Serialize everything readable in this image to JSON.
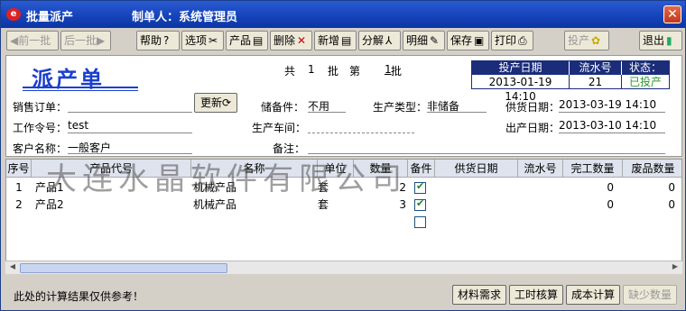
{
  "window": {
    "title": "批量派产",
    "creator": "制单人：系统管理员",
    "close_glyph": "✕"
  },
  "toolbar": {
    "prev_batch": "前一批",
    "next_batch": "后一批",
    "help": "帮助",
    "options": "选项",
    "product": "产品",
    "delete": "删除",
    "add": "新增",
    "decompose": "分解",
    "detail": "明细",
    "save": "保存",
    "print": "打印",
    "produce": "投产",
    "exit": "退出"
  },
  "header": {
    "doc_title": "派产单",
    "batch_total_label": "共",
    "batch_total": "1",
    "batch_unit": "批",
    "batch_no_label": "第",
    "batch_no": "1",
    "batch_no_unit": "批",
    "status_table": {
      "headers": [
        "投产日期",
        "流水号",
        "状态："
      ],
      "values": [
        "2013-01-19 14:10",
        "21",
        "已投产"
      ],
      "status_color": "#2a9a2a"
    },
    "fields": {
      "sales_order_label": "销售订单：",
      "sales_order_value": "",
      "update_button": "更新",
      "stock_part_label": "储备件：",
      "stock_part_value": "不用",
      "production_type_label": "生产类型：",
      "production_type_value": "非储备",
      "supply_date_label": "供货日期：",
      "supply_date_value": "2013-03-19 14:10",
      "work_order_label": "工作令号：",
      "work_order_value": "test",
      "workshop_label": "生产车间：",
      "workshop_value": "",
      "ship_date_label": "出产日期：",
      "ship_date_value": "2013-03-10 14:10",
      "customer_label": "客户名称：",
      "customer_value": "一般客户",
      "remark_label": "备注：",
      "remark_value": ""
    }
  },
  "grid": {
    "columns": [
      "序号",
      "产品代号",
      "名称",
      "单位",
      "数量",
      "备件",
      "供货日期",
      "流水号",
      "完工数量",
      "废品数量"
    ],
    "rows": [
      {
        "no": "1",
        "code": "产品1",
        "name": "机械产品",
        "unit": "套",
        "qty": "2",
        "spare": true,
        "supply": "",
        "serial": "",
        "done": "0",
        "scrap": "0"
      },
      {
        "no": "2",
        "code": "产品2",
        "name": "机械产品",
        "unit": "套",
        "qty": "3",
        "spare": true,
        "supply": "",
        "serial": "",
        "done": "0",
        "scrap": "0"
      },
      {
        "no": "",
        "code": "",
        "name": "",
        "unit": "",
        "qty": "",
        "spare": false,
        "supply": "",
        "serial": "",
        "done": "",
        "scrap": ""
      }
    ],
    "watermark": "大连水晶软件有限公司"
  },
  "footer": {
    "note": "此处的计算结果仅供参考！",
    "material_demand": "材料需求",
    "work_hours": "工时核算",
    "cost_calc": "成本计算",
    "shortage_qty": "缺少数量"
  }
}
